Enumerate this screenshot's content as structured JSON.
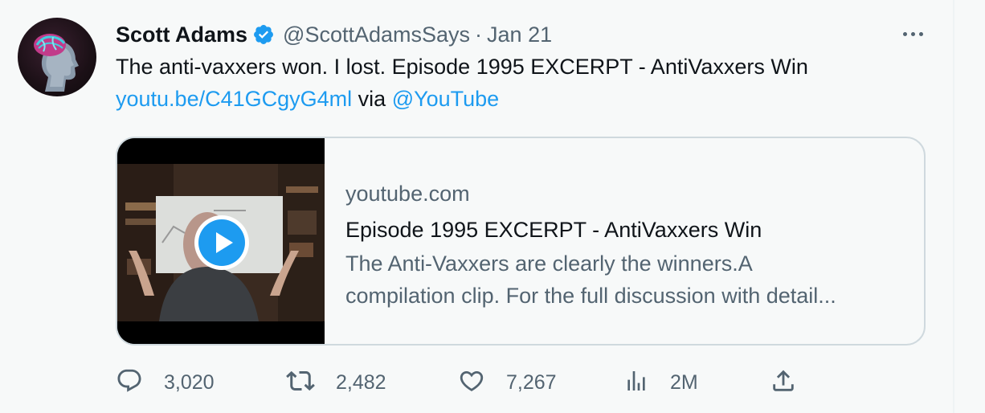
{
  "tweet": {
    "author_name": "Scott Adams",
    "handle": "@ScottAdamsSays",
    "separator": "·",
    "date": "Jan 21",
    "text_line1": "The anti-vaxxers won. I lost. Episode 1995 EXCERPT -  AntiVaxxers Win",
    "link_url": "youtu.be/C41GCgyG4ml",
    "via_text": "via",
    "mention": "@YouTube"
  },
  "card": {
    "domain": "youtube.com",
    "title": "Episode 1995 EXCERPT - AntiVaxxers Win",
    "description_line1": "The Anti-Vaxxers are clearly the winners.A",
    "description_line2": "compilation clip. For the full discussion with detail..."
  },
  "actions": {
    "replies": "3,020",
    "retweets": "2,482",
    "likes": "7,267",
    "views": "2M"
  },
  "icons": {
    "verified": "verified-badge-icon",
    "more": "more-icon",
    "play": "play-icon",
    "reply": "reply-icon",
    "retweet": "retweet-icon",
    "like": "heart-icon",
    "views": "views-icon",
    "share": "share-icon"
  },
  "colors": {
    "link": "#1d9bf0",
    "secondary_text": "#536471",
    "primary_text": "#0f1419",
    "background": "#f7f9f9",
    "card_border": "#cfd9de"
  }
}
